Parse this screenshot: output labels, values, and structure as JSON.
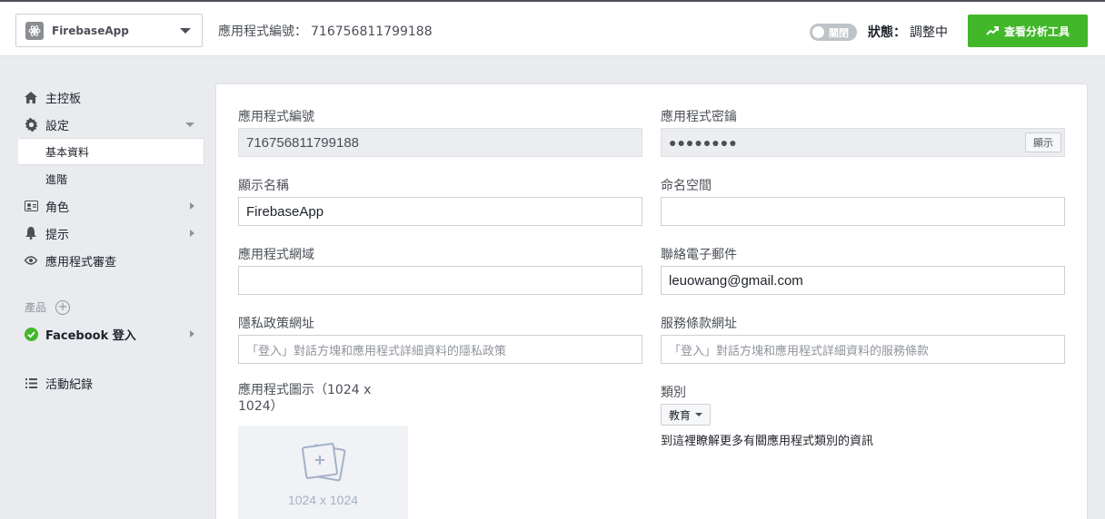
{
  "header": {
    "app_name": "FirebaseApp",
    "app_id_label": "應用程式編號：",
    "app_id_value": "716756811799188",
    "toggle_label": "關閉",
    "status_label": "狀態：",
    "status_value": "調整中",
    "analytics_button": "查看分析工具"
  },
  "sidebar": {
    "dashboard": "主控板",
    "settings": "設定",
    "settings_basic": "基本資料",
    "settings_advanced": "進階",
    "roles": "角色",
    "alerts": "提示",
    "app_review": "應用程式審查",
    "products_label": "產品",
    "facebook_login": "Facebook 登入",
    "activity_log": "活動紀錄"
  },
  "form": {
    "app_id_label": "應用程式編號",
    "app_id_value": "716756811799188",
    "app_secret_label": "應用程式密鑰",
    "app_secret_value": "●●●●●●●●",
    "show_button": "顯示",
    "display_name_label": "顯示名稱",
    "display_name_value": "FirebaseApp",
    "namespace_label": "命名空間",
    "namespace_value": "",
    "app_domains_label": "應用程式網域",
    "app_domains_value": "",
    "contact_email_label": "聯絡電子郵件",
    "contact_email_value": "leuowang@gmail.com",
    "privacy_label": "隱私政策網址",
    "privacy_placeholder": "「登入」對話方塊和應用程式詳細資料的隱私政策",
    "terms_label": "服務條款網址",
    "terms_placeholder": "「登入」對話方塊和應用程式詳細資料的服務條款",
    "app_icon_label": "應用程式圖示（1024 x 1024）",
    "app_icon_size": "1024 x 1024",
    "category_label": "類別",
    "category_value": "教育",
    "category_link": "到這裡瞭解更多有關應用程式類別的資訊"
  },
  "colors": {
    "accent_green": "#42b72a",
    "check_green": "#42b72a"
  }
}
